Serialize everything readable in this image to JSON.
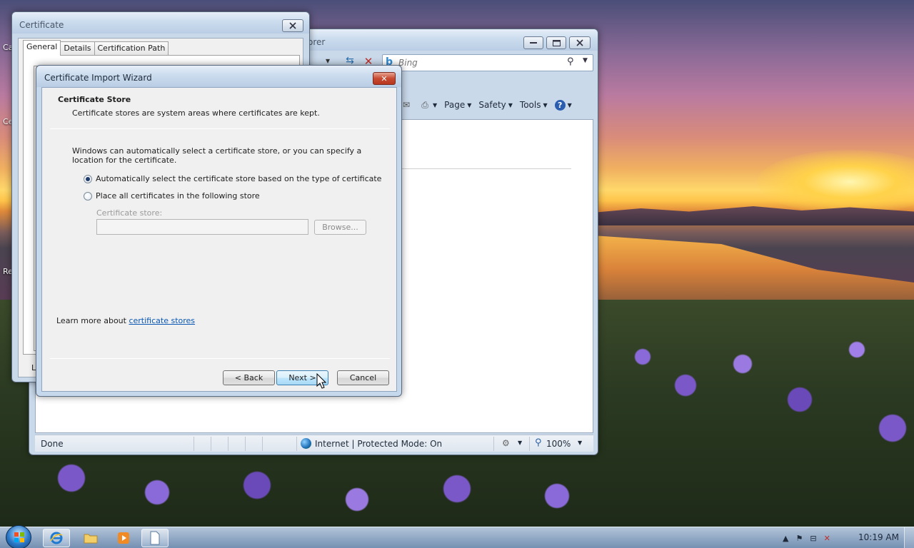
{
  "desktop": {
    "icon_labels": [
      "Ca",
      "Ce",
      "Re",
      "Le"
    ]
  },
  "ie": {
    "title_partial": "orer",
    "search": {
      "placeholder": "Bing"
    },
    "commands": {
      "page": "Page",
      "safety": "Safety",
      "tools": "Tools",
      "help": "?"
    },
    "status": {
      "done": "Done",
      "zone": "Internet | Protected Mode: On",
      "zoom": "100%"
    }
  },
  "certificate": {
    "title": "Certificate",
    "tabs": [
      "General",
      "Details",
      "Certification Path"
    ],
    "active_tab": "General"
  },
  "wizard": {
    "title": "Certificate Import Wizard",
    "close_glyph": "✕",
    "header_title": "Certificate Store",
    "header_subtitle": "Certificate stores are system areas where certificates are kept.",
    "intro": "Windows can automatically select a certificate store, or you can specify a location for the certificate.",
    "options": [
      {
        "label": "Automatically select the certificate store based on the type of certificate",
        "selected": true
      },
      {
        "label": "Place all certificates in the following store",
        "selected": false
      }
    ],
    "store_label": "Certificate store:",
    "store_value": "",
    "browse_label": "Browse...",
    "learn_prefix": "Learn more about ",
    "learn_link": "certificate stores",
    "buttons": {
      "back": "< Back",
      "next": "Next >",
      "cancel": "Cancel"
    }
  },
  "taskbar": {
    "clock": "10:19 AM"
  },
  "colors": {
    "link": "#0b58b4",
    "close_red": "#c74a31",
    "title_gradient_top": "#e6eef8"
  }
}
